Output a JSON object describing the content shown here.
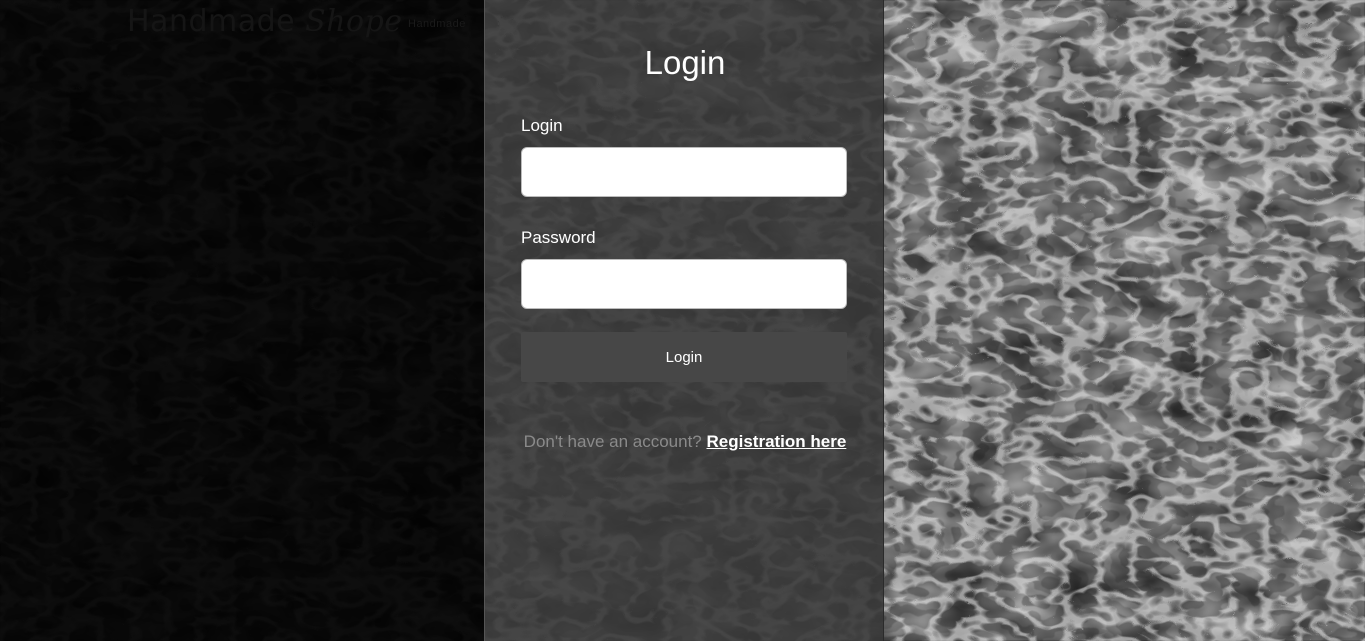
{
  "header": {
    "brand_main": "Handmade ",
    "brand_script": "Shope",
    "brand_sub": "Handmade"
  },
  "login_form": {
    "title": "Login",
    "login_label": "Login",
    "login_value": "",
    "password_label": "Password",
    "password_value": "",
    "submit_label": "Login",
    "register_prompt": "Don't have an account?",
    "register_link": "Registration here"
  },
  "colors": {
    "panel_background": "#383838",
    "button_background": "#484848",
    "prompt_text": "#8a8a8a",
    "link_text": "#ffffff"
  }
}
